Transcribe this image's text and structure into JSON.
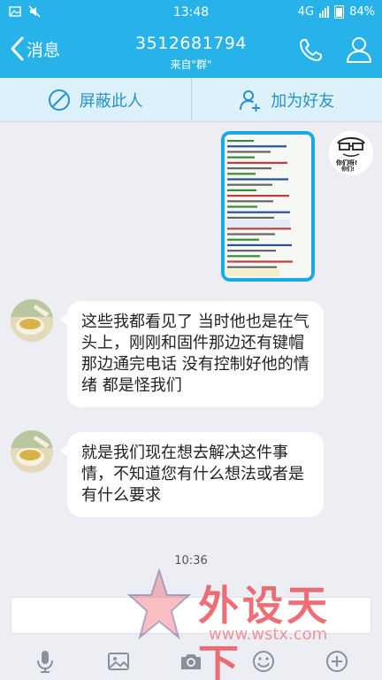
{
  "status_bar": {
    "time": "13:48",
    "network": "4G",
    "battery": "84%"
  },
  "header": {
    "back_label": "消息",
    "title": "3512681794",
    "subtitle": "来自\"群\""
  },
  "actions": {
    "block_label": "屏蔽此人",
    "add_friend_label": "加为好友"
  },
  "messages": [
    {
      "from": "me",
      "type": "image",
      "sticker_text": "你们呀! 你们! Naive!"
    },
    {
      "from": "other",
      "type": "text",
      "text": "这些我都看见了  当时他也是在气头上，刚刚和固件那边还有键帽那边通完电话  没有控制好他的情绪 都是怪我们"
    },
    {
      "from": "other",
      "type": "text",
      "text": "就是我们现在想去解决这件事情，不知道您有什么想法或者是有什么要求"
    }
  ],
  "timestamp": "10:36",
  "input": {
    "placeholder": ""
  },
  "toolbar": [
    "mic-icon",
    "image-icon",
    "camera-icon",
    "emoji-icon",
    "plus-icon"
  ],
  "watermark": {
    "text": "外设天下",
    "url": "www.wstx.com"
  },
  "colors": {
    "primary": "#27b3e9",
    "action_bar": "#dcf1fa",
    "action_text": "#2693c8",
    "background": "#eceef4"
  }
}
